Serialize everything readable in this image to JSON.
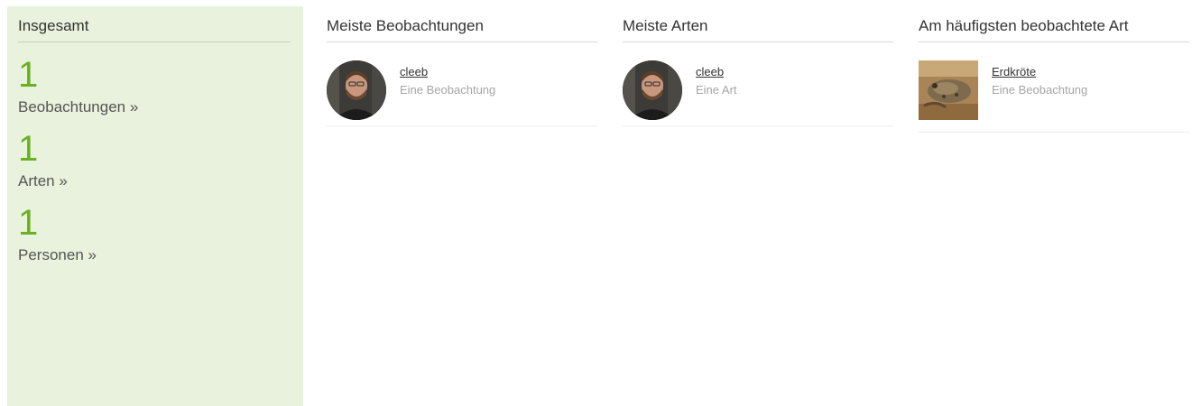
{
  "summary": {
    "title": "Insgesamt",
    "stats": [
      {
        "count": "1",
        "label": "Beobachtungen »"
      },
      {
        "count": "1",
        "label": "Arten »"
      },
      {
        "count": "1",
        "label": "Personen »"
      }
    ]
  },
  "columns": [
    {
      "title": "Meiste Beobachtungen",
      "entry": {
        "name": "cleeb",
        "sub": "Eine Beobachtung",
        "image": "user-avatar"
      }
    },
    {
      "title": "Meiste Arten",
      "entry": {
        "name": "cleeb",
        "sub": "Eine Art",
        "image": "user-avatar"
      }
    },
    {
      "title": "Am häufigsten beobachtete Art",
      "entry": {
        "name": "Erdkröte",
        "sub": "Eine Beobachtung",
        "image": "species-photo"
      }
    }
  ],
  "colors": {
    "panel_bg": "#e8f2dd",
    "count_green": "#6ab023",
    "muted_text": "#a5a5a5"
  }
}
